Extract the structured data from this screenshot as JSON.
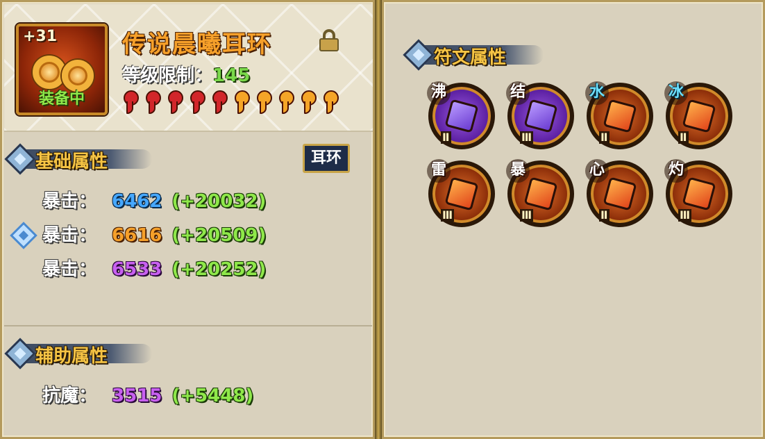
{
  "item": {
    "enhance_level": "+31",
    "name": "传说晨曦耳环",
    "equipped_label": "装备中",
    "level_label": "等级限制：",
    "level_value": "145",
    "stars": [
      "red",
      "red",
      "red",
      "red",
      "red",
      "orange",
      "orange",
      "orange",
      "orange",
      "orange"
    ]
  },
  "base_attributes": {
    "title": "基础属性",
    "type_tag": "耳环",
    "rows": [
      {
        "label": "暴击：",
        "value": "6462",
        "bonus": "(+20032)",
        "color": "#46a8ff"
      },
      {
        "label": "暴击：",
        "value": "6616",
        "bonus": "(+20509)",
        "color": "#f6a02a"
      },
      {
        "label": "暴击：",
        "value": "6533",
        "bonus": "(+20252)",
        "color": "#c860f0"
      }
    ]
  },
  "aux_attributes": {
    "title": "辅助属性",
    "rows": [
      {
        "label": "抗魔：",
        "value": "3515",
        "bonus": "(+5448)",
        "color": "#c860f0"
      }
    ]
  },
  "runes": {
    "title": "符文属性",
    "items": [
      {
        "char": "沸",
        "level": "Ⅱ",
        "style": "purple"
      },
      {
        "char": "结",
        "level": "Ⅲ",
        "style": "purple"
      },
      {
        "char": "水",
        "level": "Ⅱ",
        "style": "orange"
      },
      {
        "char": "冰",
        "level": "Ⅱ",
        "style": "orange"
      },
      {
        "char": "雷",
        "level": "Ⅲ",
        "style": "orange"
      },
      {
        "char": "暴",
        "level": "Ⅲ",
        "style": "orange"
      },
      {
        "char": "心",
        "level": "Ⅱ",
        "style": "orange"
      },
      {
        "char": "灼",
        "level": "Ⅲ",
        "style": "orange"
      }
    ]
  },
  "icons": [
    "lock-icon",
    "diamond-gem-icon",
    "earring-icon",
    "rune-icon"
  ]
}
